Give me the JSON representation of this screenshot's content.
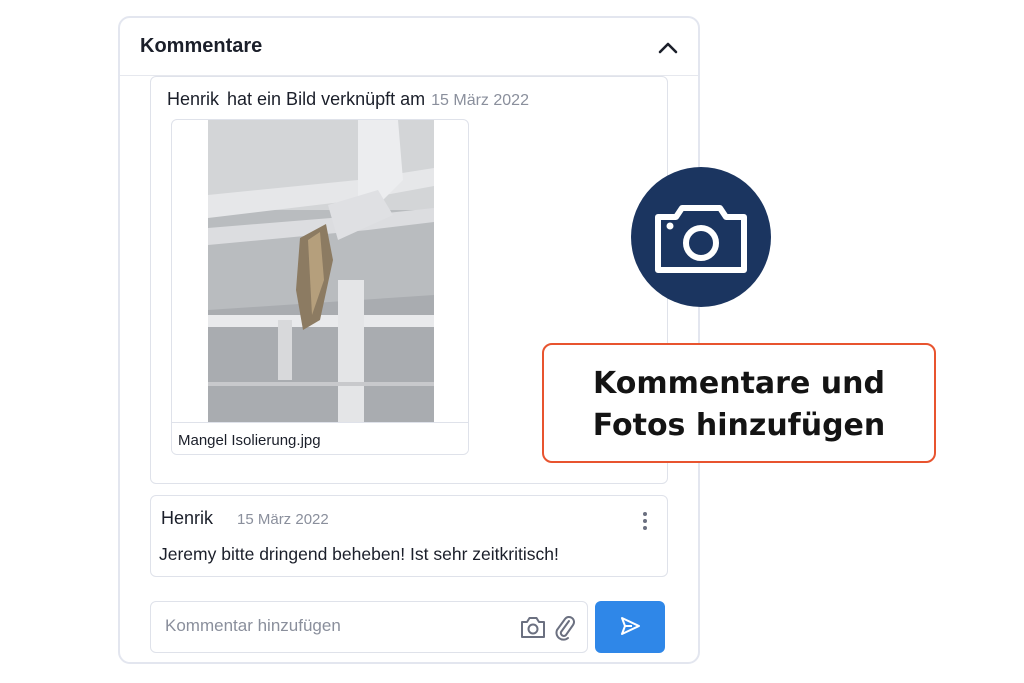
{
  "panel": {
    "title": "Kommentare"
  },
  "activity": {
    "user": "Henrik",
    "action": "hat ein Bild verknüpft am",
    "date": "15 März 2022",
    "attachment": {
      "filename": "Mangel Isolierung.jpg"
    }
  },
  "comment": {
    "user": "Henrik",
    "date": "15 März 2022",
    "mention": "Jeremy",
    "text": "bitte dringend beheben! Ist sehr zeitkritisch!"
  },
  "composer": {
    "placeholder": "Kommentar hinzufügen"
  },
  "callout": {
    "line1": "Kommentare und",
    "line2": "Fotos hinzufügen"
  },
  "colors": {
    "accent": "#2f87e8",
    "badge": "#1b3560",
    "callout_border": "#e8542f"
  },
  "icons": [
    "chevron-up-icon",
    "more-vertical-icon",
    "camera-icon",
    "paperclip-icon",
    "send-icon"
  ]
}
